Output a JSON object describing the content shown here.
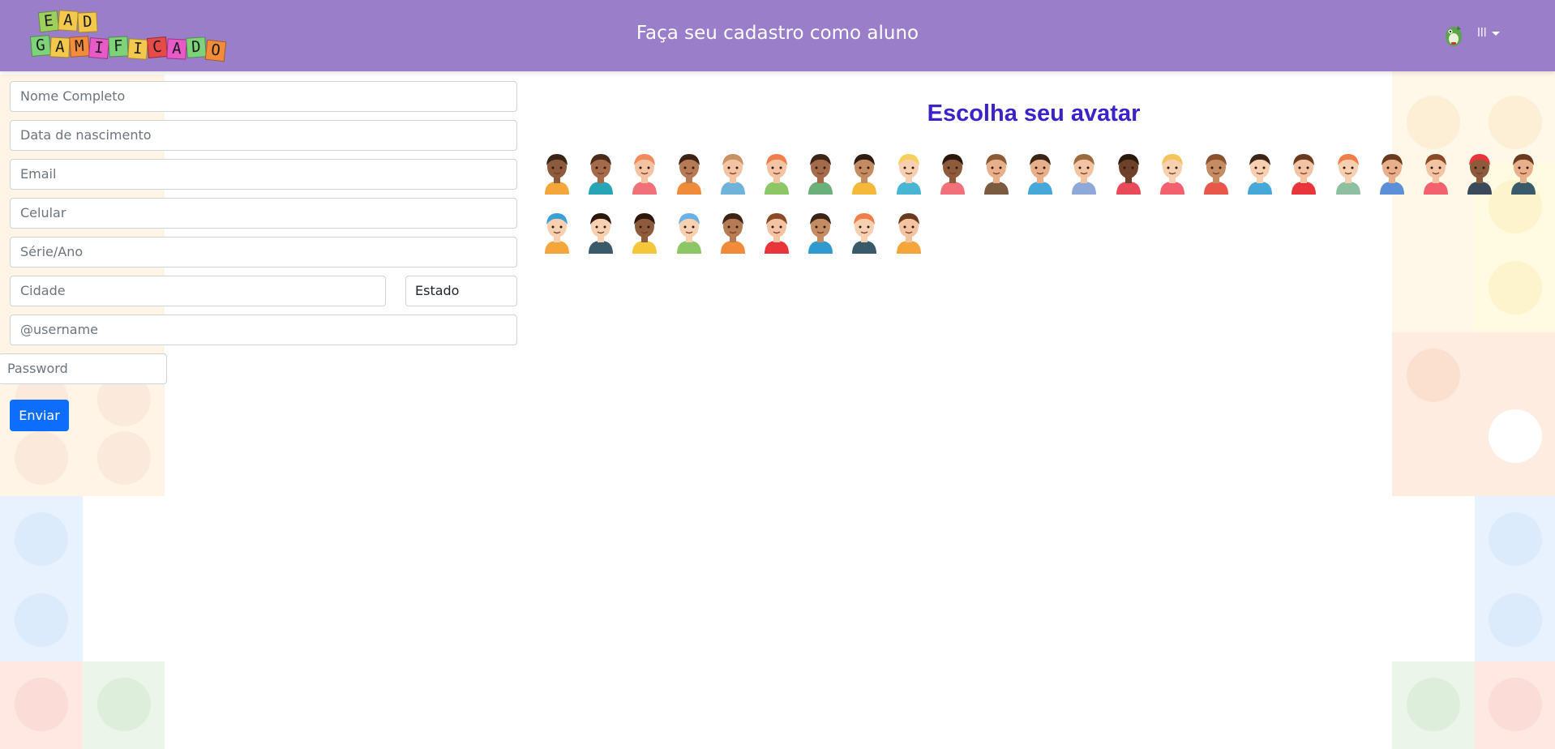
{
  "header": {
    "logo_letters": [
      "E",
      "A",
      "D",
      "G",
      "A",
      "M",
      "I",
      "F",
      "I",
      "C",
      "A",
      "D",
      "O"
    ],
    "title": "Faça seu cadastro como aluno",
    "user_menu_label": "lll",
    "brand_color": "#9b7ec9"
  },
  "form": {
    "full_name_placeholder": "Nome Completo",
    "birth_date_placeholder": "Data de nascimento",
    "email_placeholder": "Email",
    "phone_placeholder": "Celular",
    "grade_placeholder": "Série/Ano",
    "city_placeholder": "Cidade",
    "state_selected": "Estado",
    "username_placeholder": "@username",
    "password_placeholder": "Password",
    "submit_label": "Enviar",
    "submit_color": "#0d6efd"
  },
  "avatar_picker": {
    "title": "Escolha seu avatar",
    "title_color": "#3d22c9",
    "avatars": [
      {
        "skin": "#8d5a3b",
        "hair": "#3a2416",
        "shirt": "#f4a63a"
      },
      {
        "skin": "#a46b4b",
        "hair": "#4a2a18",
        "shirt": "#27a4b6"
      },
      {
        "skin": "#f3c3a2",
        "hair": "#f08b5c",
        "shirt": "#f0717a"
      },
      {
        "skin": "#b67a55",
        "hair": "#3c2214",
        "shirt": "#f08b3a"
      },
      {
        "skin": "#f3c3a2",
        "hair": "#c79363",
        "shirt": "#6fb3d8"
      },
      {
        "skin": "#f3c3a2",
        "hair": "#f07d4a",
        "shirt": "#8cc665"
      },
      {
        "skin": "#a46b4b",
        "hair": "#3c2416",
        "shirt": "#6ab07a"
      },
      {
        "skin": "#c48c62",
        "hair": "#2e1c10",
        "shirt": "#f4b93a"
      },
      {
        "skin": "#f6d0b0",
        "hair": "#f6cf5c",
        "shirt": "#49b5d4"
      },
      {
        "skin": "#8d5a3b",
        "hair": "#2b170c",
        "shirt": "#f0717a"
      },
      {
        "skin": "#e8b08a",
        "hair": "#8a5a36",
        "shirt": "#7a5b40"
      },
      {
        "skin": "#e8b08a",
        "hair": "#3a2416",
        "shirt": "#46a8d8"
      },
      {
        "skin": "#f3c3a2",
        "hair": "#9b6a3e",
        "shirt": "#8ea8d8"
      },
      {
        "skin": "#6e412a",
        "hair": "#2b170c",
        "shirt": "#e84a5a"
      },
      {
        "skin": "#f6d0b0",
        "hair": "#f6c45c",
        "shirt": "#f2616d"
      },
      {
        "skin": "#c48c62",
        "hair": "#8a5230",
        "shirt": "#e8574a"
      },
      {
        "skin": "#f6d0b0",
        "hair": "#3a2416",
        "shirt": "#46a8d8"
      },
      {
        "skin": "#f3c3a2",
        "hair": "#6a3a1e",
        "shirt": "#e8343a"
      },
      {
        "skin": "#f6d0b0",
        "hair": "#f07d4a",
        "shirt": "#8cc0a0"
      },
      {
        "skin": "#e8b08a",
        "hair": "#6a3a1e",
        "shirt": "#5d8fd8"
      },
      {
        "skin": "#f3c3a2",
        "hair": "#8a4a28",
        "shirt": "#f2616d"
      },
      {
        "skin": "#8d5a3b",
        "hair": "#e8343a",
        "shirt": "#3a4a5a"
      },
      {
        "skin": "#e8b08a",
        "hair": "#6a3a1e",
        "shirt": "#3a5a6a"
      },
      {
        "skin": "#f6d0b0",
        "hair": "#3aa0d8",
        "shirt": "#f4a63a"
      },
      {
        "skin": "#f6d0b0",
        "hair": "#2b170c",
        "shirt": "#3a5a6a"
      },
      {
        "skin": "#8d5a3b",
        "hair": "#2b170c",
        "shirt": "#f4c63a"
      },
      {
        "skin": "#f6d0b0",
        "hair": "#6ab0e8",
        "shirt": "#8cc665"
      },
      {
        "skin": "#b67a55",
        "hair": "#3a2416",
        "shirt": "#f08b3a"
      },
      {
        "skin": "#f3c3a2",
        "hair": "#8a4a28",
        "shirt": "#e8343a"
      },
      {
        "skin": "#c48c62",
        "hair": "#3a2416",
        "shirt": "#2e9ad0"
      },
      {
        "skin": "#f6d0b0",
        "hair": "#f07d4a",
        "shirt": "#3a5a6a"
      },
      {
        "skin": "#f3c3a2",
        "hair": "#6a3a1e",
        "shirt": "#f4a63a"
      }
    ]
  }
}
